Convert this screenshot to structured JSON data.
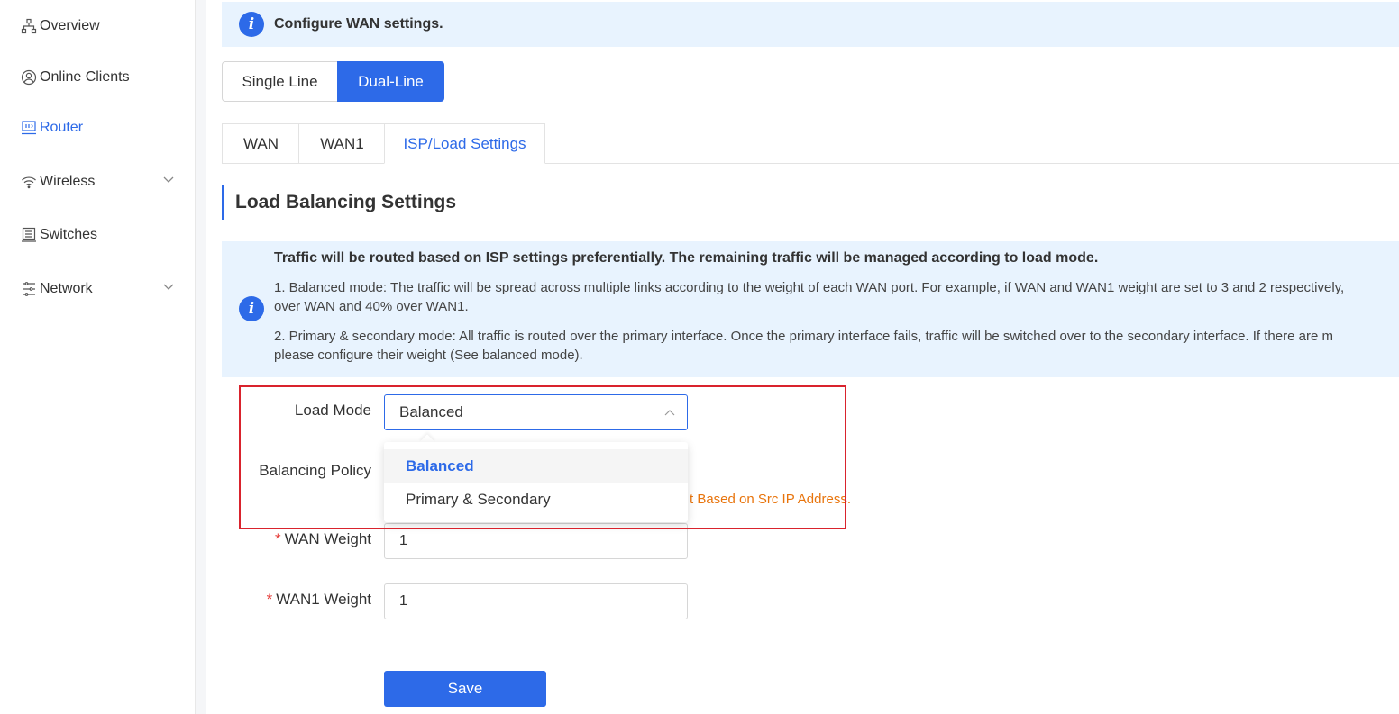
{
  "sidebar": {
    "items": [
      {
        "label": "Overview",
        "icon": "sitemap-icon"
      },
      {
        "label": "Online Clients",
        "icon": "user-circle-icon"
      },
      {
        "label": "Router",
        "icon": "router-icon",
        "active": true
      },
      {
        "label": "Wireless",
        "icon": "wifi-icon",
        "expandable": true
      },
      {
        "label": "Switches",
        "icon": "switch-icon"
      },
      {
        "label": "Network",
        "icon": "network-icon",
        "expandable": true
      }
    ]
  },
  "banner": {
    "text": "Configure WAN settings."
  },
  "line_mode": {
    "single": "Single Line",
    "dual": "Dual-Line",
    "selected": "Dual-Line"
  },
  "tabs": [
    {
      "label": "WAN"
    },
    {
      "label": "WAN1"
    },
    {
      "label": "ISP/Load Settings",
      "active": true
    }
  ],
  "section": {
    "title": "Load Balancing Settings"
  },
  "info": {
    "line1": "Traffic will be routed based on ISP settings preferentially. The remaining traffic will be managed according to load mode.",
    "line2a": "1. Balanced mode: The traffic will be spread across multiple links according to the weight of each WAN port. For example, if WAN and WAN1 weight are set to 3 and 2 respectively,",
    "line2b": "over WAN and 40% over WAN1.",
    "line3a": "2. Primary & secondary mode: All traffic is routed over the primary interface. Once the primary interface fails, traffic will be switched over to the secondary interface. If there are m",
    "line3b": "please configure their weight (See balanced mode)."
  },
  "form": {
    "load_mode_label": "Load Mode",
    "load_mode_value": "Balanced",
    "load_mode_options": [
      "Balanced",
      "Primary & Secondary"
    ],
    "balancing_policy_label": "Balancing Policy",
    "balancing_policy_hint": "t Based on Src IP Address.",
    "wan_weight_label": "WAN Weight",
    "wan_weight_value": "1",
    "wan1_weight_label": "WAN1 Weight",
    "wan1_weight_value": "1",
    "required_mark": "*",
    "save_label": "Save"
  },
  "colors": {
    "accent": "#2d6ae8",
    "highlight": "#d9232d",
    "warning": "#e8740c",
    "info_bg": "#e8f3fe"
  }
}
